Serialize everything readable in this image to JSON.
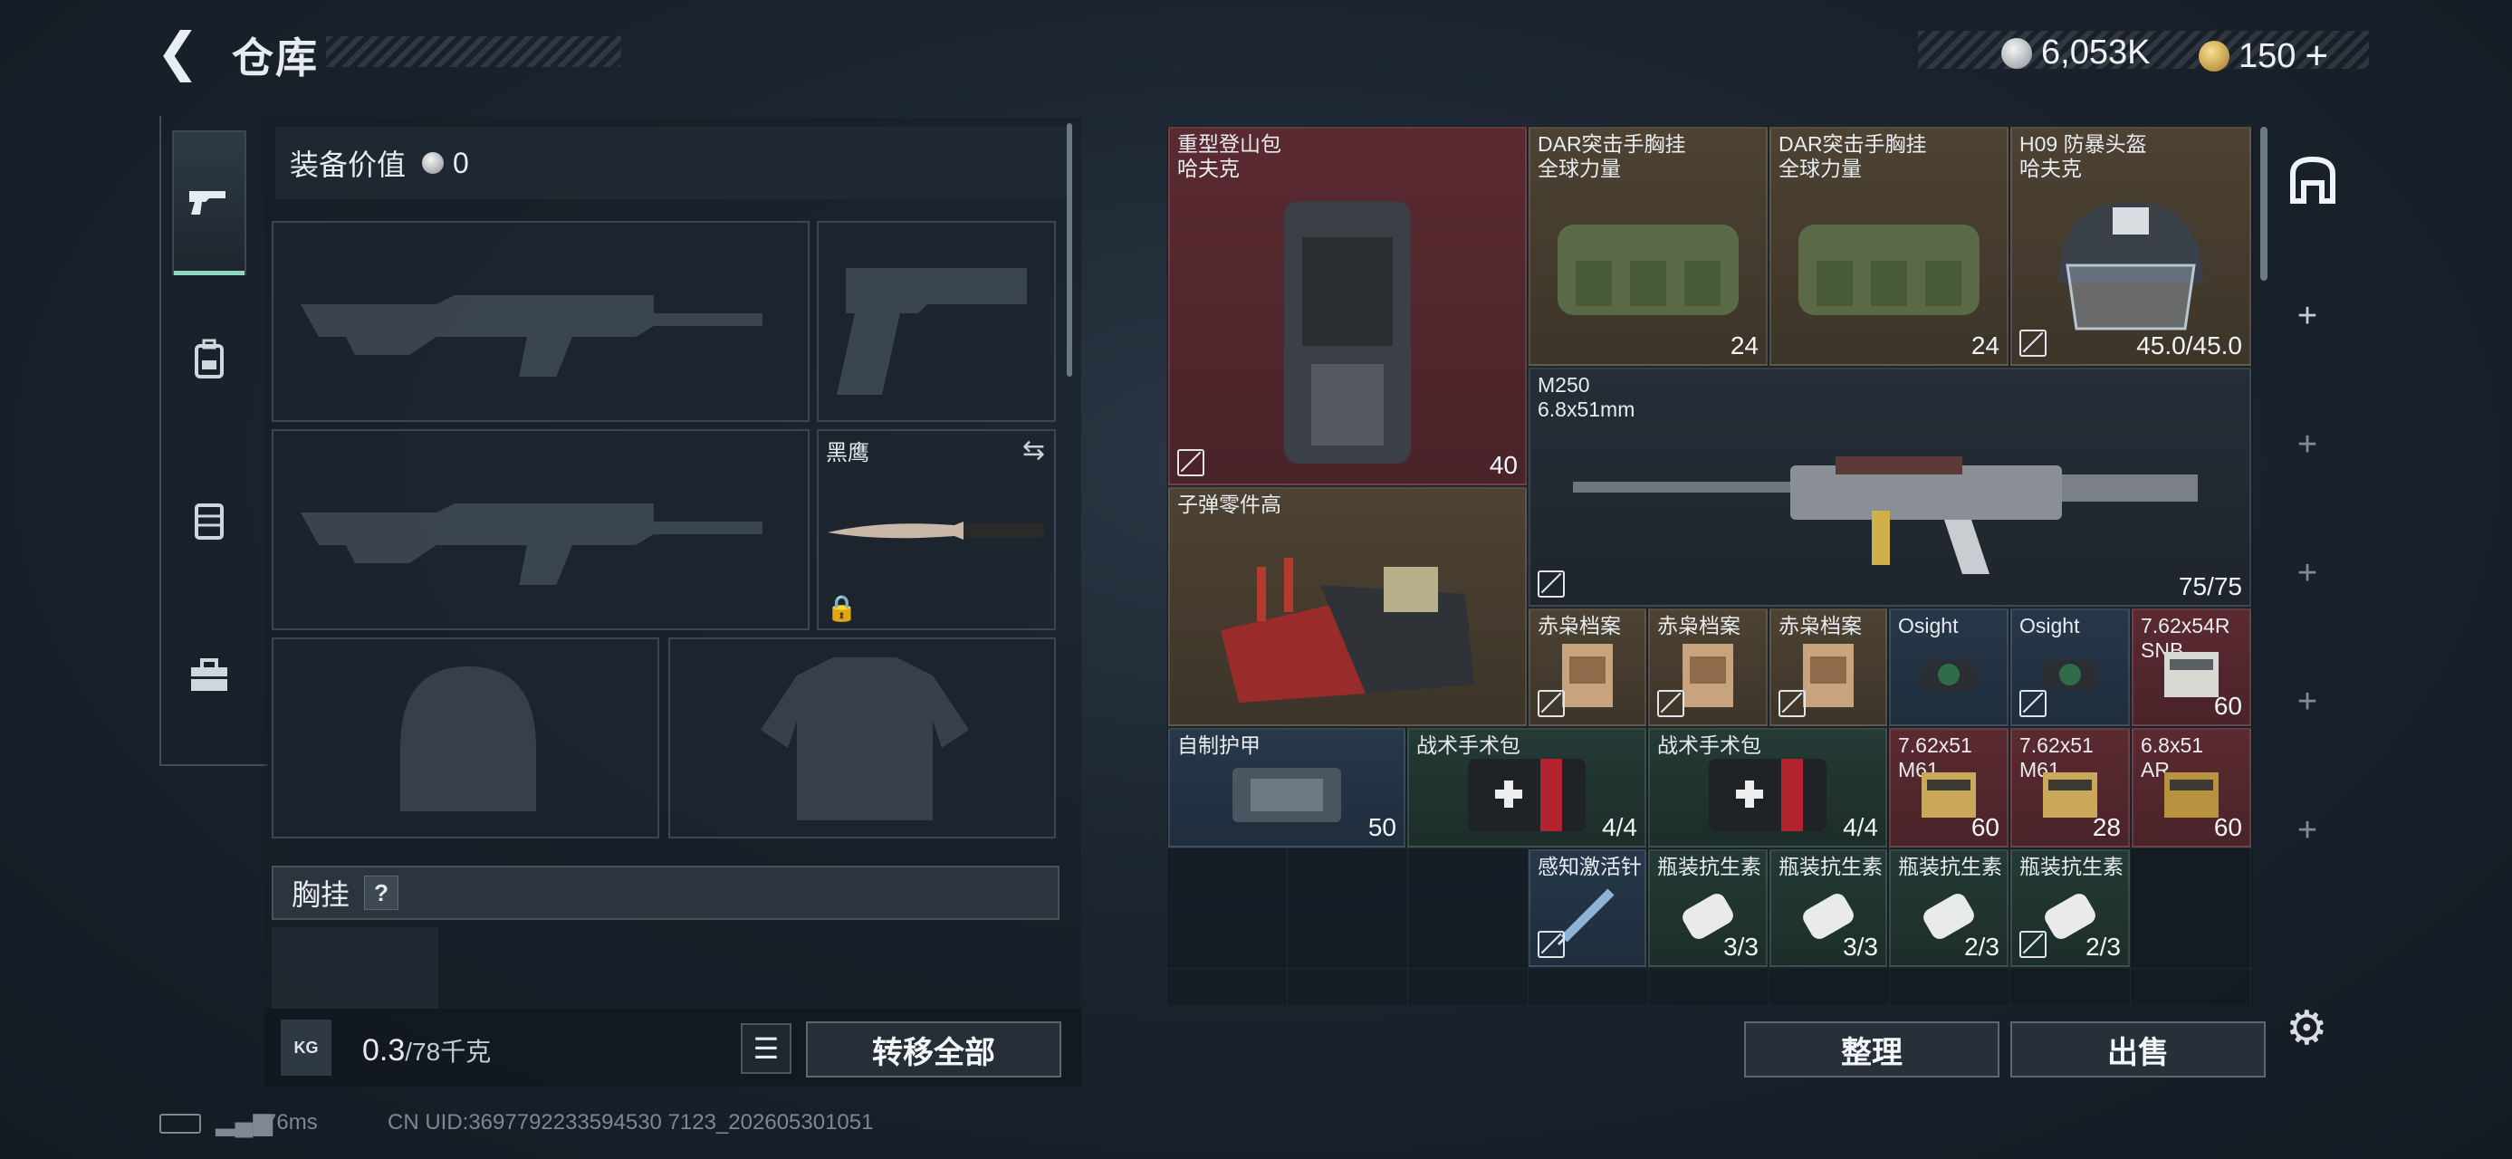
{
  "topbar": {
    "title": "仓库",
    "silver_amount": "6,053K",
    "gold_amount": "150",
    "gold_plus": "+"
  },
  "equipment": {
    "value_label": "装备价值",
    "value": "0",
    "knife_name": "黑鹰",
    "chest_label": "胸挂",
    "chest_help": "?"
  },
  "weight": {
    "kg_icon_label": "KG",
    "current": "0.3",
    "capacity": "/78千克"
  },
  "buttons": {
    "transfer_all": "转移全部",
    "sort": "整理",
    "sell": "出售"
  },
  "items": [
    {
      "name": "重型登山包\n哈夫克",
      "value": "40"
    },
    {
      "name": "DAR突击手胸挂\n全球力量",
      "value": "24"
    },
    {
      "name": "DAR突击手胸挂\n全球力量",
      "value": "24"
    },
    {
      "name": "H09 防暴头盔\n哈夫克",
      "value": "45.0/45.0"
    },
    {
      "name": "M250\n6.8x51mm",
      "value": "75/75"
    },
    {
      "name": "子弹零件高",
      "value": ""
    },
    {
      "name": "赤枭档案",
      "value": ""
    },
    {
      "name": "赤枭档案",
      "value": ""
    },
    {
      "name": "赤枭档案",
      "value": ""
    },
    {
      "name": "Osight",
      "value": ""
    },
    {
      "name": "Osight",
      "value": ""
    },
    {
      "name": "7.62x54R\nSNB",
      "value": "60"
    },
    {
      "name": "自制护甲",
      "value": "50"
    },
    {
      "name": "战术手术包",
      "value": "4/4"
    },
    {
      "name": "战术手术包",
      "value": "4/4"
    },
    {
      "name": "7.62x51\nM61",
      "value": "60"
    },
    {
      "name": "7.62x51\nM61",
      "value": "28"
    },
    {
      "name": "6.8x51\nAR",
      "value": "60"
    },
    {
      "name": "感知激活针",
      "value": ""
    },
    {
      "name": "瓶装抗生素",
      "value": "3/3"
    },
    {
      "name": "瓶装抗生素",
      "value": "3/3"
    },
    {
      "name": "瓶装抗生素",
      "value": "2/3"
    },
    {
      "name": "瓶装抗生素",
      "value": "2/3"
    }
  ],
  "status": {
    "ping": "76ms",
    "uid": "CN UID:3697792233594530 7123_202605301051"
  },
  "colors": {
    "accent": "#8fd7c1",
    "rarity_red": "#5b2a31",
    "rarity_gold": "#4d4233",
    "rarity_blue": "#27384a",
    "rarity_green": "#243a35"
  }
}
